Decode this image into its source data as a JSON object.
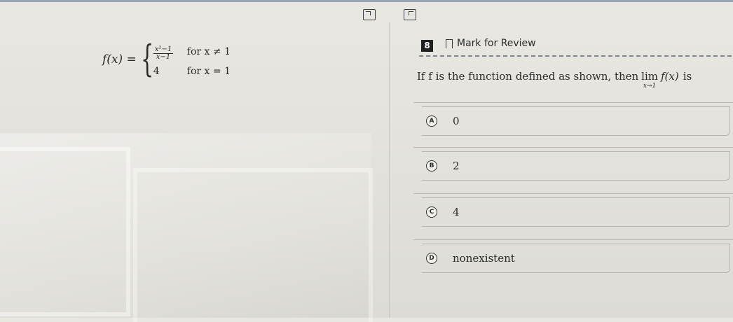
{
  "toolbar": {
    "left_icon": "expand-icon",
    "right_icon": "collapse-icon"
  },
  "function": {
    "lhs": "f(x) =",
    "cases": [
      {
        "value_num": "x²−1",
        "value_den": "x−1",
        "condition": "for x ≠ 1"
      },
      {
        "value": "4",
        "condition": "for x = 1"
      }
    ]
  },
  "question": {
    "number": "8",
    "mark_for_review": "Mark for Review",
    "text_before": "If f is the function defined as shown, then",
    "lim": "lim",
    "lim_sub": "x→1",
    "fx": "f(x)",
    "text_after": "is"
  },
  "choices": [
    {
      "letter": "A",
      "text": "0"
    },
    {
      "letter": "B",
      "text": "2"
    },
    {
      "letter": "C",
      "text": "4"
    },
    {
      "letter": "D",
      "text": "nonexistent"
    }
  ]
}
